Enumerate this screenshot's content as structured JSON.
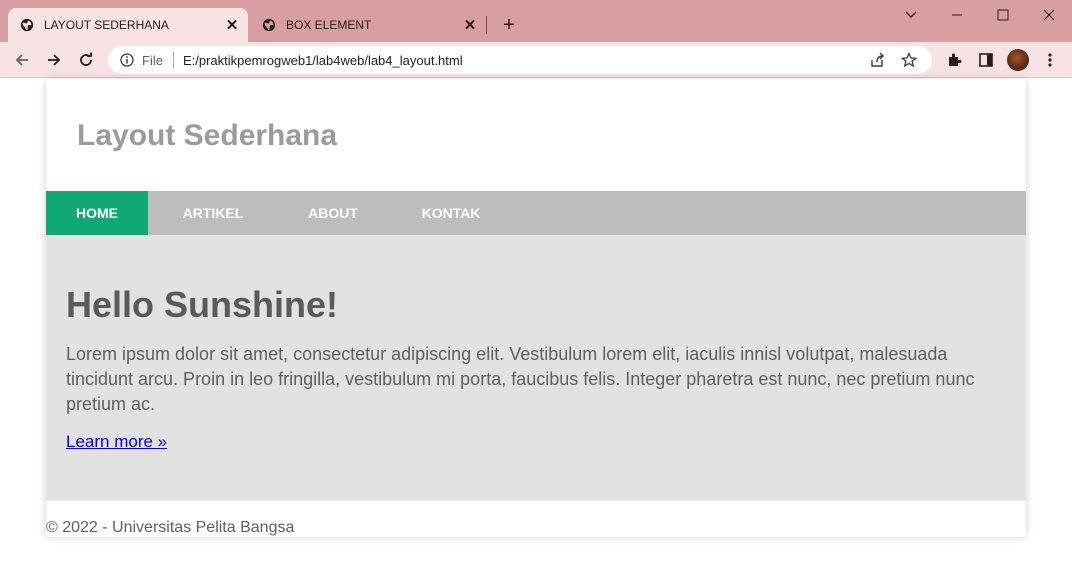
{
  "browser": {
    "tabs": [
      {
        "title": "LAYOUT SEDERHANA",
        "active": true
      },
      {
        "title": "BOX ELEMENT",
        "active": false
      }
    ],
    "address": {
      "scheme_label": "File",
      "url": "E:/praktikpemrogweb1/lab4web/lab4_layout.html"
    },
    "colors": {
      "tabbar": "#d89fa3",
      "toolbar": "#f7e3e4"
    }
  },
  "page": {
    "header_title": "Layout Sederhana",
    "nav": [
      {
        "label": "HOME",
        "active": true
      },
      {
        "label": "ARTIKEL",
        "active": false
      },
      {
        "label": "ABOUT",
        "active": false
      },
      {
        "label": "KONTAK",
        "active": false
      }
    ],
    "hero": {
      "heading": "Hello Sunshine!",
      "body": "Lorem ipsum dolor sit amet, consectetur adipiscing elit. Vestibulum lorem elit, iaculis innisl volutpat, malesuada tincidunt arcu. Proin in leo fringilla, vestibulum mi porta, faucibus felis. Integer pharetra est nunc, nec pretium nunc pretium ac.",
      "link": "Learn more »"
    },
    "footer": "© 2022 - Universitas Pelita Bangsa",
    "colors": {
      "nav_active": "#12a875",
      "nav_bg": "#bdbdbd",
      "hero_bg": "#e2e2e2"
    }
  }
}
